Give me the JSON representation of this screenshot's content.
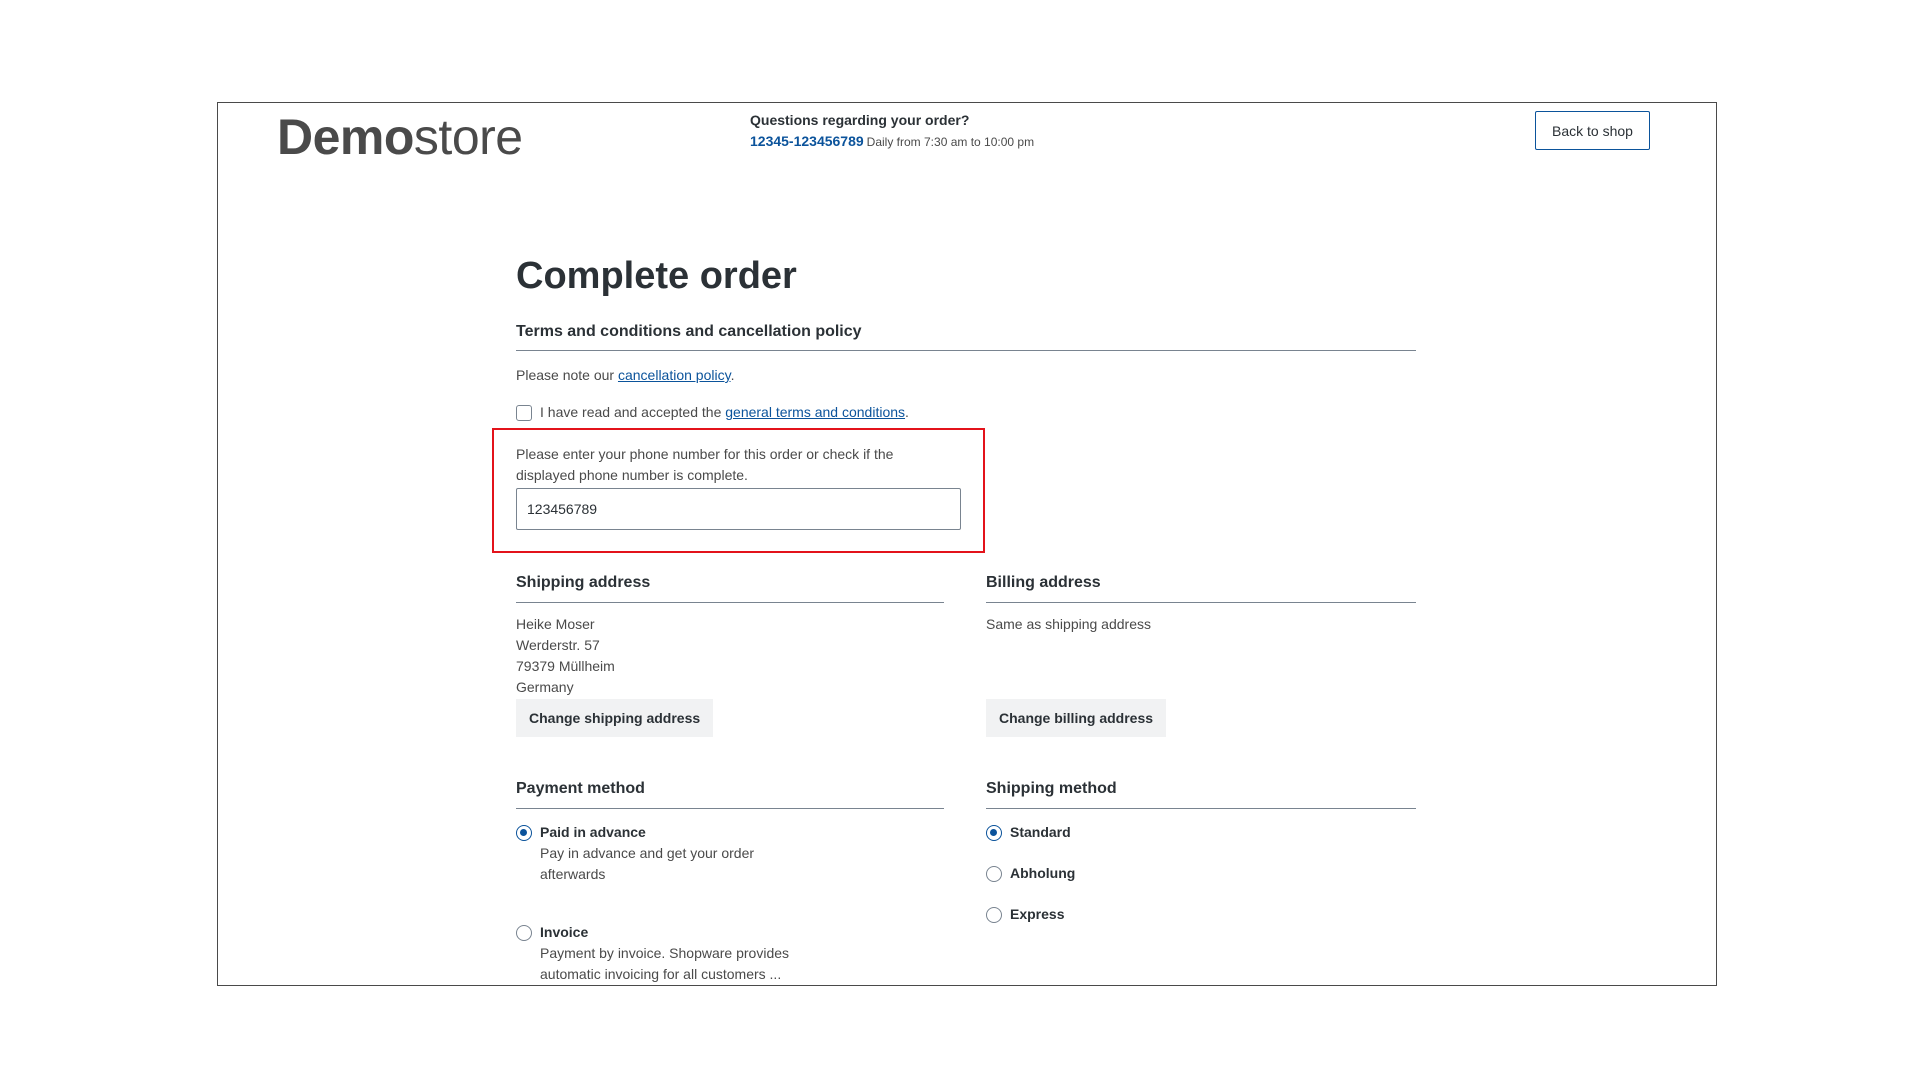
{
  "header": {
    "logo_bold": "Demo",
    "logo_light": "store",
    "hotline_question": "Questions regarding your order?",
    "hotline_number": "12345-123456789",
    "hotline_hours": "Daily from 7:30 am to 10:00 pm",
    "back_label": "Back to shop"
  },
  "page": {
    "title": "Complete order"
  },
  "terms": {
    "heading": "Terms and conditions and cancellation policy",
    "note_prefix": "Please note our ",
    "note_link": "cancellation policy",
    "note_suffix": ".",
    "accept_prefix": "I have read and accepted the ",
    "accept_link": "general terms and conditions",
    "accept_suffix": ".",
    "accept_checked": false
  },
  "phone": {
    "prompt_line1": "Please enter your phone number for this order or check if the",
    "prompt_line2": "displayed phone number is complete.",
    "value": "123456789"
  },
  "shipping_address": {
    "heading": "Shipping address",
    "lines": [
      "Heike Moser",
      "Werderstr. 57",
      "79379 Müllheim",
      "Germany"
    ],
    "change_label": "Change shipping address"
  },
  "billing_address": {
    "heading": "Billing address",
    "text": "Same as shipping address",
    "change_label": "Change billing address"
  },
  "payment": {
    "heading": "Payment method",
    "options": [
      {
        "label": "Paid in advance",
        "desc_line1": "Pay in advance and get your order",
        "desc_line2": "afterwards",
        "selected": true
      },
      {
        "label": "Invoice",
        "desc_line1": "Payment by invoice. Shopware provides",
        "desc_line2": "automatic invoicing for all customers ...",
        "selected": false
      }
    ]
  },
  "shipping_method": {
    "heading": "Shipping method",
    "options": [
      {
        "label": "Standard",
        "selected": true
      },
      {
        "label": "Abholung",
        "selected": false
      },
      {
        "label": "Express",
        "selected": false
      }
    ]
  },
  "colors": {
    "accent": "#0b539b",
    "highlight_box": "#e3131b",
    "text": "#2b3136",
    "button_bg": "#f1f2f3"
  }
}
